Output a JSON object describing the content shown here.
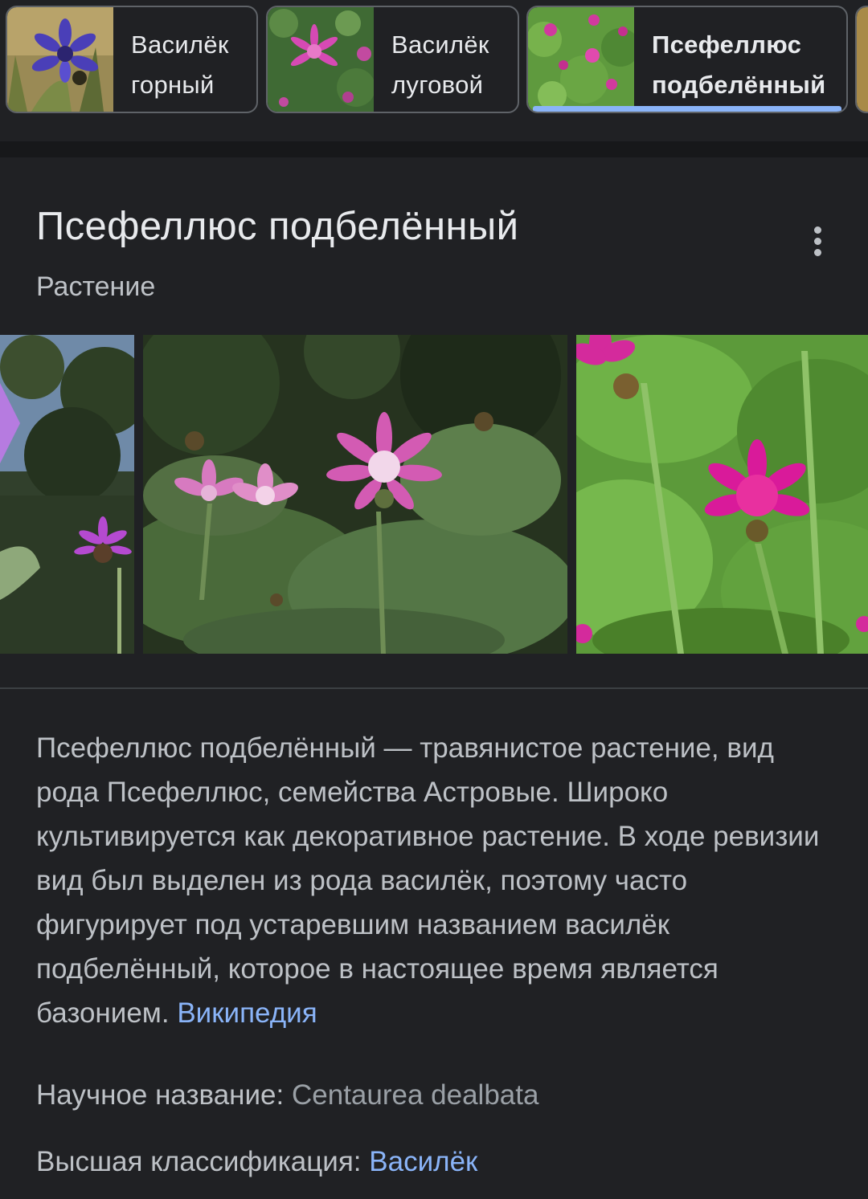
{
  "chips": [
    {
      "label": "Василёк\nгорный",
      "active": false
    },
    {
      "label": "Василёк\nлуговой",
      "active": false
    },
    {
      "label": "Псефеллюс\nподбелённый",
      "active": true
    }
  ],
  "card": {
    "title": "Псефеллюс подбелённый",
    "subtitle": "Растение",
    "description": "Псефеллюс подбелённый — травянистое растение, вид рода Псефеллюс, семейства Астровые. Широко культивируется как декоративное растение. В ходе ревизии вид был выделен из рода василёк, поэтому часто фигурирует под устаревшим названием василёк подбелённый, которое в настоящее время является базонием.",
    "source_link": "Википедия",
    "facts": [
      {
        "label": "Научное название:",
        "value": "Centaurea dealbata"
      },
      {
        "label": "Высшая классификация:",
        "value": "Василёк"
      }
    ]
  },
  "colors": {
    "background": "#202124",
    "accent": "#8ab4f8",
    "text": "#e8eaed",
    "secondary_text": "#bdc1c6"
  },
  "icons": {
    "more": "more-vert-icon"
  }
}
